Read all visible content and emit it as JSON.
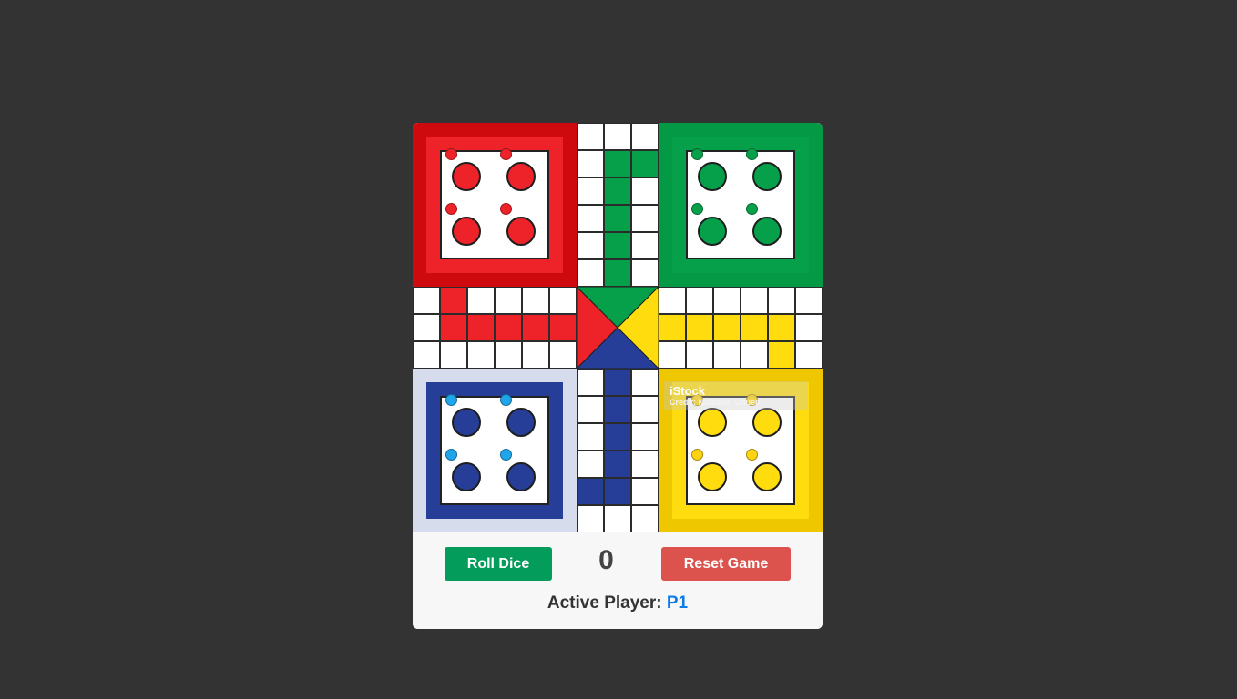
{
  "colors": {
    "background": "#333333",
    "panel": "#f7f7f7",
    "red": "#ee2229",
    "red_dark": "#cf0a0f",
    "green": "#07a04a",
    "green_dark": "#049a45",
    "blue": "#263e97",
    "blue_light": "#d7dcec",
    "yellow": "#ffdc0d",
    "yellow_dark": "#efc700",
    "roll_button": "#049c5a",
    "reset_button": "#db534c",
    "player_accent": "#0f7be6"
  },
  "board": {
    "yards": [
      {
        "name": "red",
        "pawn_color": "#ee2229"
      },
      {
        "name": "green",
        "pawn_color": "#07a04a"
      },
      {
        "name": "blue",
        "pawn_color": "#1ea5ea"
      },
      {
        "name": "yellow",
        "pawn_color": "#ffd30f"
      }
    ],
    "watermark": {
      "brand": "iStock",
      "credit": "Credit: Natasha_Chuen"
    }
  },
  "controls": {
    "roll_label": "Roll Dice",
    "dice_value": "0",
    "reset_label": "Reset Game",
    "active_label": "Active Player:",
    "active_player": "P1"
  }
}
